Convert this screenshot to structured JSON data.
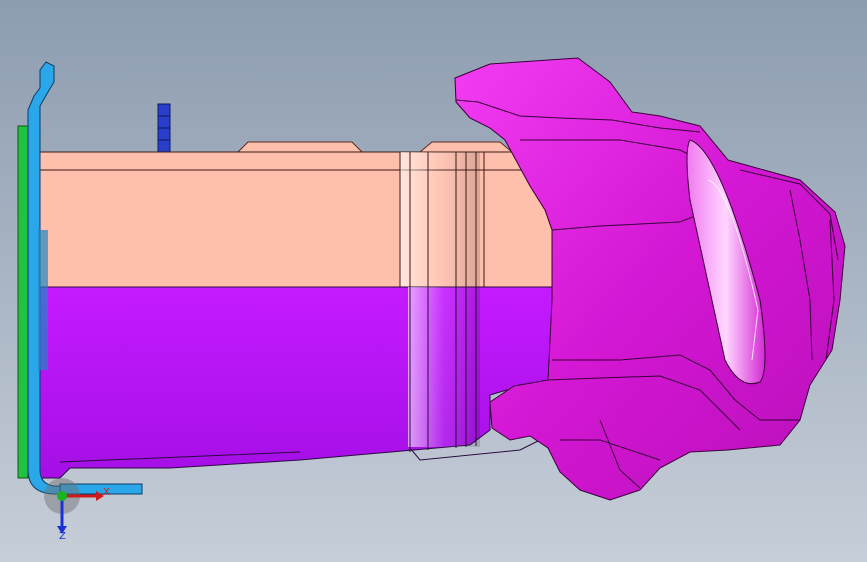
{
  "viewport": {
    "background_top": "#8d9cb0",
    "background_bottom": "#c6ced8"
  },
  "parts": {
    "part_a_color": "#ffbfad",
    "part_b_color": "#c214ff",
    "part_c_color": "#e61ae6",
    "bracket_color": "#2aa7e8",
    "plate_color": "#21c23f",
    "post_color": "#2a3fc9"
  },
  "triad": {
    "x_label": "X",
    "z_label": "Z",
    "x_color": "#d11a1a",
    "y_color": "#19b51f",
    "z_color": "#1a2fd6"
  }
}
